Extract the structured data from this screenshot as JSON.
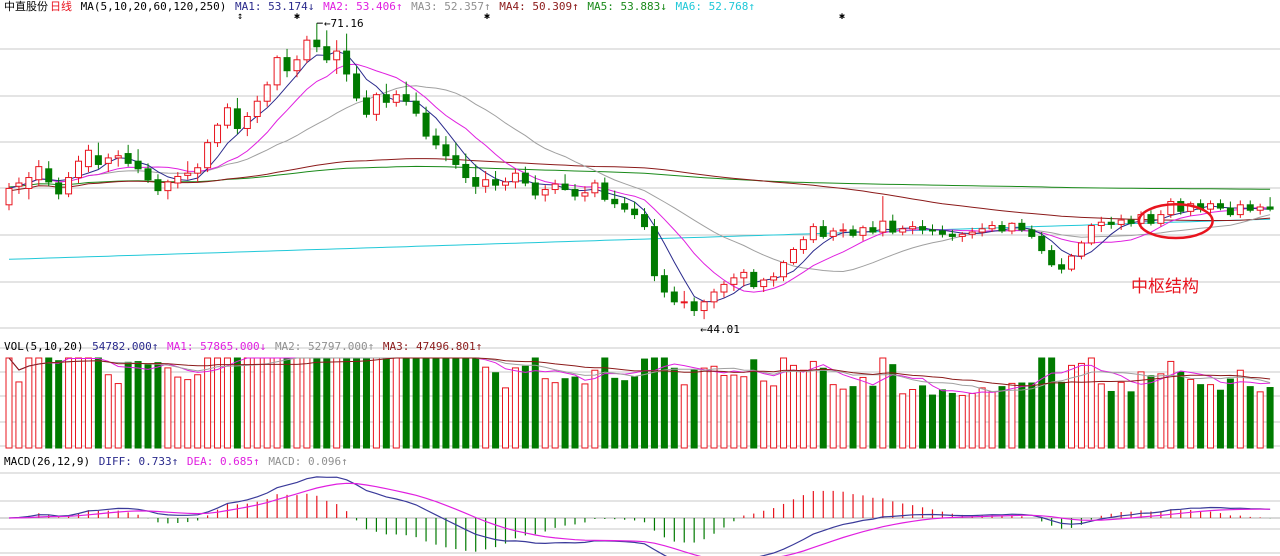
{
  "header": {
    "stock_name": "中直股份",
    "period": "日线",
    "ma_label": "MA(5,10,20,60,120,250)",
    "ma1": "MA1: 53.174↓",
    "ma2": "MA2: 53.406↑",
    "ma3": "MA3: 52.357↑",
    "ma4": "MA4: 50.309↑",
    "ma5": "MA5: 53.883↓",
    "ma6": "MA6: 52.768↑"
  },
  "vol_header": {
    "label": "VOL(5,10,20)",
    "vol": "54782.000↑",
    "ma1": "MA1: 57865.000↓",
    "ma2": "MA2: 52797.000↑",
    "ma3": "MA3: 47496.801↑"
  },
  "macd_header": {
    "label": "MACD(26,12,9)",
    "diff": "DIFF: 0.733↑",
    "dea": "DEA: 0.685↑",
    "macd": "MACD: 0.096↑"
  },
  "annotations": {
    "high": "71.16",
    "low": "44.01",
    "pivot_text": "中枢结构"
  },
  "colors": {
    "up": "#e8141e",
    "down": "#007a00",
    "ma1": "#2a2a8c",
    "ma2": "#e020e0",
    "ma3": "#a0a0a0",
    "ma4": "#8b1a1a",
    "ma5": "#1a8a1a",
    "ma6": "#20c8d8",
    "diff": "#3a3a9a",
    "dea": "#e020e0"
  },
  "chart_data": {
    "type": "candlestick",
    "ylim": [
      44.01,
      71.16
    ],
    "high_value": 71.16,
    "low_value": 44.01,
    "ohlc": [
      [
        54.5,
        56.5,
        54.0,
        56.0
      ],
      [
        56.2,
        57.0,
        55.5,
        56.5
      ],
      [
        56.0,
        57.5,
        55.0,
        57.0
      ],
      [
        56.8,
        58.6,
        56.2,
        58.0
      ],
      [
        57.8,
        58.5,
        56.2,
        56.6
      ],
      [
        56.5,
        57.0,
        55.0,
        55.5
      ],
      [
        55.5,
        57.5,
        55.2,
        57.0
      ],
      [
        57.0,
        59.0,
        56.5,
        58.5
      ],
      [
        58.0,
        60.0,
        57.5,
        59.5
      ],
      [
        59.0,
        60.2,
        57.8,
        58.2
      ],
      [
        58.3,
        59.2,
        57.5,
        58.8
      ],
      [
        58.8,
        59.5,
        58.0,
        59.0
      ],
      [
        59.2,
        60.0,
        58.0,
        58.3
      ],
      [
        58.5,
        59.6,
        57.4,
        57.8
      ],
      [
        57.8,
        58.3,
        56.5,
        56.8
      ],
      [
        56.8,
        57.3,
        55.4,
        55.8
      ],
      [
        55.8,
        56.8,
        55.0,
        56.6
      ],
      [
        56.5,
        57.5,
        56.0,
        57.1
      ],
      [
        57.2,
        58.5,
        56.8,
        57.4
      ],
      [
        57.4,
        58.3,
        56.6,
        57.9
      ],
      [
        57.9,
        60.5,
        57.5,
        60.2
      ],
      [
        60.2,
        62.0,
        59.8,
        61.8
      ],
      [
        61.8,
        63.8,
        61.5,
        63.4
      ],
      [
        63.3,
        64.3,
        61.0,
        61.5
      ],
      [
        61.5,
        63.0,
        60.8,
        62.6
      ],
      [
        62.6,
        64.5,
        62.0,
        64.0
      ],
      [
        64.0,
        65.8,
        63.5,
        65.5
      ],
      [
        65.5,
        68.2,
        65.0,
        68.0
      ],
      [
        68.0,
        68.8,
        66.2,
        66.8
      ],
      [
        66.8,
        68.2,
        66.2,
        67.8
      ],
      [
        67.8,
        70.0,
        67.5,
        69.6
      ],
      [
        69.6,
        71.16,
        68.5,
        69.0
      ],
      [
        69.0,
        70.5,
        67.5,
        67.8
      ],
      [
        67.8,
        69.6,
        66.5,
        68.6
      ],
      [
        68.6,
        70.2,
        65.8,
        66.5
      ],
      [
        66.5,
        67.2,
        64.0,
        64.3
      ],
      [
        64.3,
        65.0,
        62.5,
        62.8
      ],
      [
        62.8,
        64.8,
        62.2,
        64.6
      ],
      [
        64.6,
        65.6,
        63.4,
        63.9
      ],
      [
        63.9,
        65.0,
        63.5,
        64.6
      ],
      [
        64.6,
        65.8,
        63.6,
        64.0
      ],
      [
        64.0,
        64.8,
        62.6,
        62.9
      ],
      [
        62.9,
        63.5,
        60.5,
        60.8
      ],
      [
        60.8,
        61.5,
        59.6,
        60.0
      ],
      [
        60.0,
        60.8,
        58.5,
        59.0
      ],
      [
        59.0,
        60.2,
        57.8,
        58.2
      ],
      [
        58.2,
        59.2,
        56.5,
        57.0
      ],
      [
        57.0,
        58.2,
        55.5,
        56.2
      ],
      [
        56.2,
        57.6,
        55.6,
        56.8
      ],
      [
        56.8,
        57.6,
        55.8,
        56.3
      ],
      [
        56.3,
        57.0,
        55.8,
        56.6
      ],
      [
        56.6,
        57.8,
        56.0,
        57.4
      ],
      [
        57.4,
        58.0,
        56.2,
        56.5
      ],
      [
        56.5,
        57.2,
        55.0,
        55.4
      ],
      [
        55.4,
        56.3,
        54.8,
        55.9
      ],
      [
        55.9,
        56.8,
        55.5,
        56.4
      ],
      [
        56.4,
        57.3,
        55.8,
        55.9
      ],
      [
        55.9,
        56.4,
        54.9,
        55.3
      ],
      [
        55.3,
        56.2,
        54.8,
        55.6
      ],
      [
        55.6,
        56.8,
        55.2,
        56.5
      ],
      [
        56.5,
        57.0,
        54.8,
        55.0
      ],
      [
        55.0,
        55.8,
        54.2,
        54.6
      ],
      [
        54.6,
        55.2,
        53.8,
        54.1
      ],
      [
        54.1,
        54.8,
        53.2,
        53.6
      ],
      [
        53.6,
        54.2,
        52.2,
        52.5
      ],
      [
        52.5,
        53.2,
        47.5,
        48.0
      ],
      [
        48.0,
        48.6,
        46.0,
        46.5
      ],
      [
        46.5,
        47.0,
        45.3,
        45.6
      ],
      [
        45.6,
        46.6,
        45.0,
        45.6
      ],
      [
        45.6,
        46.0,
        44.3,
        44.8
      ],
      [
        44.8,
        45.8,
        44.01,
        45.6
      ],
      [
        45.6,
        46.8,
        45.0,
        46.5
      ],
      [
        46.5,
        47.5,
        46.0,
        47.2
      ],
      [
        47.2,
        48.2,
        46.6,
        47.8
      ],
      [
        47.8,
        48.6,
        47.0,
        48.3
      ],
      [
        48.3,
        48.6,
        46.8,
        47.0
      ],
      [
        47.0,
        47.8,
        46.5,
        47.6
      ],
      [
        47.6,
        48.3,
        47.0,
        47.9
      ],
      [
        47.9,
        49.4,
        47.5,
        49.2
      ],
      [
        49.2,
        50.6,
        49.0,
        50.4
      ],
      [
        50.4,
        51.6,
        50.0,
        51.3
      ],
      [
        51.3,
        52.8,
        51.0,
        52.5
      ],
      [
        52.5,
        53.1,
        51.4,
        51.6
      ],
      [
        51.6,
        52.4,
        51.2,
        52.1
      ],
      [
        52.1,
        52.8,
        51.5,
        52.2
      ],
      [
        52.2,
        52.6,
        51.5,
        51.7
      ],
      [
        51.7,
        52.6,
        51.2,
        52.4
      ],
      [
        52.4,
        53.0,
        51.8,
        52.0
      ],
      [
        52.0,
        55.3,
        51.6,
        53.0
      ],
      [
        53.0,
        53.6,
        51.8,
        52.0
      ],
      [
        52.0,
        52.6,
        51.7,
        52.3
      ],
      [
        52.3,
        53.0,
        51.8,
        52.5
      ],
      [
        52.5,
        53.1,
        51.8,
        52.2
      ],
      [
        52.2,
        52.7,
        51.7,
        52.1
      ],
      [
        52.1,
        52.6,
        51.5,
        51.8
      ],
      [
        51.8,
        52.2,
        51.2,
        51.6
      ],
      [
        51.6,
        52.0,
        51.1,
        51.8
      ],
      [
        51.8,
        52.4,
        51.4,
        52.0
      ],
      [
        52.0,
        52.8,
        51.6,
        52.3
      ],
      [
        52.3,
        53.0,
        52.0,
        52.6
      ],
      [
        52.6,
        53.0,
        51.9,
        52.1
      ],
      [
        52.1,
        52.9,
        51.8,
        52.8
      ],
      [
        52.8,
        53.2,
        52.0,
        52.2
      ],
      [
        52.2,
        52.6,
        51.4,
        51.6
      ],
      [
        51.6,
        52.0,
        50.0,
        50.3
      ],
      [
        50.3,
        50.8,
        48.8,
        49.0
      ],
      [
        49.0,
        49.6,
        48.2,
        48.6
      ],
      [
        48.6,
        50.0,
        48.4,
        49.8
      ],
      [
        49.8,
        51.2,
        49.5,
        51.0
      ],
      [
        51.0,
        52.8,
        50.8,
        52.6
      ],
      [
        52.6,
        53.4,
        52.0,
        52.9
      ],
      [
        52.9,
        53.4,
        52.3,
        52.7
      ],
      [
        52.7,
        53.6,
        52.2,
        53.1
      ],
      [
        53.1,
        53.5,
        52.5,
        52.8
      ],
      [
        52.8,
        53.9,
        52.3,
        53.6
      ],
      [
        53.6,
        54.0,
        52.6,
        52.8
      ],
      [
        52.8,
        54.0,
        52.5,
        53.6
      ],
      [
        53.6,
        55.1,
        53.3,
        54.8
      ],
      [
        54.8,
        55.1,
        53.6,
        53.9
      ],
      [
        53.9,
        54.8,
        53.5,
        54.6
      ],
      [
        54.6,
        55.0,
        53.8,
        54.1
      ],
      [
        54.1,
        54.9,
        53.7,
        54.6
      ],
      [
        54.6,
        55.0,
        54.0,
        54.2
      ],
      [
        54.2,
        54.8,
        53.4,
        53.6
      ],
      [
        53.6,
        54.9,
        53.3,
        54.5
      ],
      [
        54.5,
        54.9,
        53.8,
        54.0
      ],
      [
        54.0,
        54.6,
        53.6,
        54.3
      ],
      [
        54.3,
        55.2,
        53.9,
        54.1
      ]
    ],
    "pivot_zone": {
      "start_index": 115,
      "end_index": 120,
      "low": 52.0,
      "high": 54.0
    },
    "vol_series_names": [
      "MA1",
      "MA2",
      "MA3"
    ],
    "macd_series_names": [
      "DIFF",
      "DEA",
      "MACD"
    ]
  }
}
